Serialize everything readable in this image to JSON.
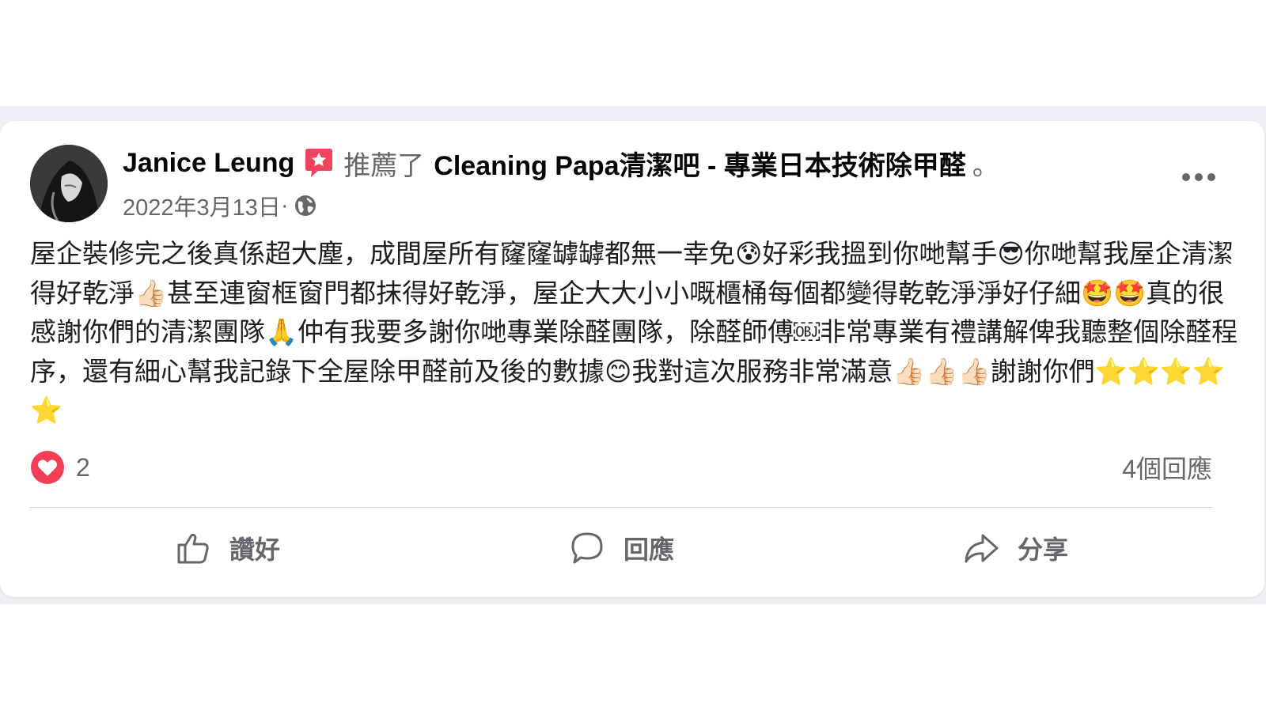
{
  "post": {
    "author": "Janice Leung",
    "recommend_verb": "推薦了",
    "page_name": "Cleaning Papa清潔吧 - 專業日本技術除甲醛",
    "period": "。",
    "date": "2022年3月13日",
    "separator": " · ",
    "body": "屋企裝修完之後真係超大塵，成間屋所有窿窿罅罅都無一幸免😰好彩我搵到你哋幫手😎你哋幫我屋企清潔得好乾淨👍🏻甚至連窗框窗門都抹得好乾淨，屋企大大小小嘅櫃桶每個都變得乾乾淨淨好仔細🤩🤩真的很感謝你們的清潔團隊🙏仲有我要多謝你哋專業除醛團隊，除醛師傅￼非常專業有禮講解俾我聽整個除醛程序，還有細心幫我記錄下全屋除甲醛前及後的數據😊我對這次服務非常滿意👍🏻👍🏻👍🏻謝謝你們⭐⭐⭐⭐⭐"
  },
  "reactions": {
    "count": "2",
    "comments": "4個回應"
  },
  "actions": {
    "like": "讚好",
    "comment": "回應",
    "share": "分享"
  },
  "icons": {
    "more": "more-dots-icon",
    "recommend": "recommend-badge-icon",
    "globe": "globe-icon",
    "heart": "heart-reaction-icon",
    "like": "thumbs-up-icon",
    "comment": "speech-bubble-icon",
    "share": "share-arrow-icon"
  },
  "colors": {
    "recommend_badge": "#f3425f",
    "heart": "#f33e58",
    "secondary_text": "#65676b"
  }
}
